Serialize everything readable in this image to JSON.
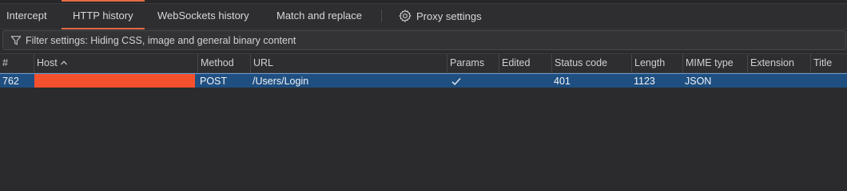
{
  "tabs": [
    {
      "label": "Intercept",
      "active": false
    },
    {
      "label": "HTTP history",
      "active": true
    },
    {
      "label": "WebSockets history",
      "active": false
    },
    {
      "label": "Match and replace",
      "active": false
    }
  ],
  "proxy_settings": {
    "label": "Proxy settings",
    "icon": "gear-icon"
  },
  "filter": {
    "label": "Filter settings: Hiding CSS, image and general binary content",
    "icon": "funnel-icon"
  },
  "table": {
    "columns": [
      "#",
      "Host",
      "Method",
      "URL",
      "Params",
      "Edited",
      "Status code",
      "Length",
      "MIME type",
      "Extension",
      "Title"
    ],
    "sorted_column": "Host",
    "sort_direction": "ascending",
    "rows": [
      {
        "id": "762",
        "host": "",
        "host_redacted": true,
        "method": "POST",
        "url": "/Users/Login",
        "params": true,
        "edited": "",
        "status_code": "401",
        "length": "1123",
        "mime_type": "JSON",
        "extension": "",
        "title": "",
        "selected": true
      }
    ]
  },
  "colors": {
    "accent": "#e46b42",
    "selection": "#1f4f80",
    "redaction": "#f5502d",
    "background": "#2b2b2d"
  }
}
